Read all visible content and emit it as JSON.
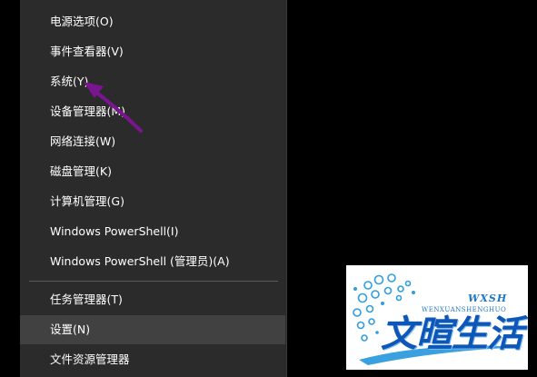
{
  "menu": {
    "items": [
      {
        "label": "电源选项(O)"
      },
      {
        "label": "事件查看器(V)"
      },
      {
        "label": "系统(Y)"
      },
      {
        "label": "设备管理器(M)"
      },
      {
        "label": "网络连接(W)"
      },
      {
        "label": "磁盘管理(K)"
      },
      {
        "label": "计算机管理(G)"
      },
      {
        "label": "Windows PowerShell(I)"
      },
      {
        "label": "Windows PowerShell (管理员)(A)"
      },
      {
        "label": "任务管理器(T)"
      },
      {
        "label": "设置(N)"
      },
      {
        "label": "文件资源管理器"
      }
    ],
    "hovered_item": "设置(N)"
  },
  "annotation": {
    "arrow_color": "#7a1590",
    "points_to": "系统(Y)"
  },
  "watermark": {
    "tag": "WXSH",
    "subtitle": "WENXUANSHENGHUO",
    "name": "文暄生活",
    "brand_color": "#0d57b8",
    "accent_color": "#3aa0e0"
  }
}
